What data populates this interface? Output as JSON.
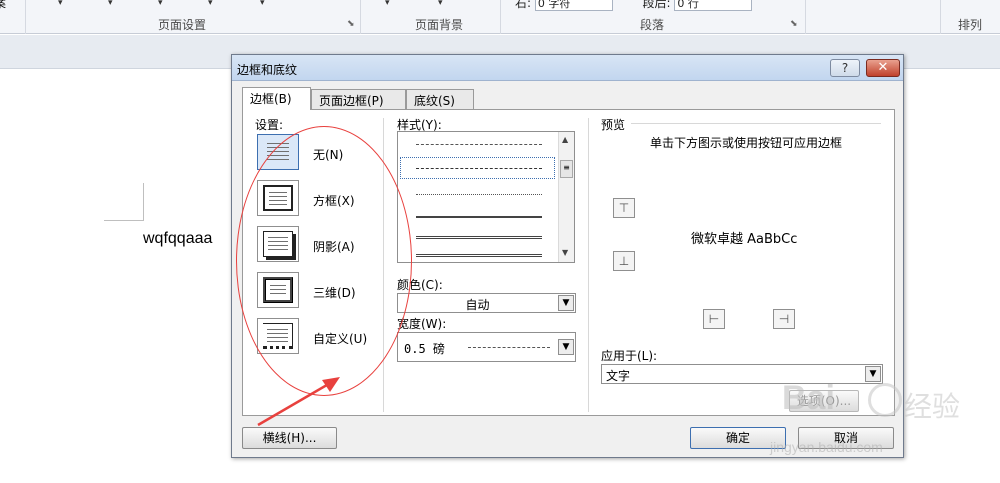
{
  "ribbon": {
    "groups": [
      "页面设置",
      "页面背景",
      "段落",
      "排列"
    ],
    "paragraph": {
      "left_label": "右:",
      "left_value": "0 字符",
      "after_label": "段后:",
      "after_value": "0 行"
    },
    "partial_left": "案"
  },
  "document": {
    "text": "wqfqqaaa"
  },
  "dialog": {
    "title": "边框和底纹",
    "help_label": "?",
    "close_label": "✕",
    "tabs": [
      "边框(B)",
      "页面边框(P)",
      "底纹(S)"
    ],
    "active_tab": 0,
    "settings_label": "设置:",
    "settings": [
      "无(N)",
      "方框(X)",
      "阴影(A)",
      "三维(D)",
      "自定义(U)"
    ],
    "selected_setting": 0,
    "style_label": "样式(Y):",
    "color_label": "颜色(C):",
    "color_value": "自动",
    "width_label": "宽度(W):",
    "width_value": "0.5 磅",
    "preview_label": "预览",
    "preview_hint": "单击下方图示或使用按钮可应用边框",
    "preview_sample": "微软卓越  AaBbCc",
    "apply_label": "应用于(L):",
    "apply_value": "文字",
    "options_button": "选项(O)...",
    "hline_button": "横线(H)...",
    "ok_button": "确定",
    "cancel_button": "取消"
  },
  "watermark": {
    "brand": "Bai",
    "brand_cn": "经验",
    "url": "jingyan.baidu.com"
  },
  "colors": {
    "annotation": "#e8413e",
    "titlebar": "#c2d6ef",
    "close": "#c0412c"
  }
}
